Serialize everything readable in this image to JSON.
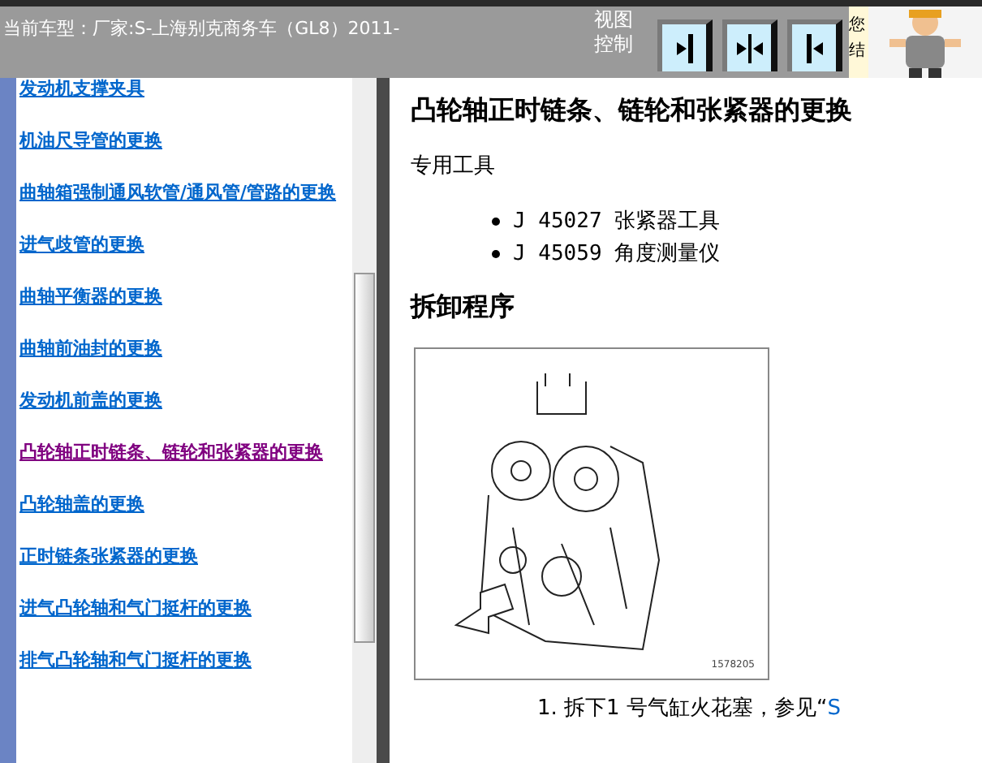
{
  "header": {
    "vehicle": "当前车型：厂家:S-上海别克商务车（GL8）2011-",
    "view_control": "视图控制",
    "side_text": "您结"
  },
  "view_buttons": [
    {
      "kind": "right"
    },
    {
      "kind": "both"
    },
    {
      "kind": "left"
    }
  ],
  "sidebar": {
    "links": [
      {
        "label": "发动机支撑夹具",
        "visited": false
      },
      {
        "label": "机油尺导管的更换",
        "visited": false
      },
      {
        "label": "曲轴箱强制通风软管/通风管/管路的更换",
        "visited": false
      },
      {
        "label": "进气歧管的更换",
        "visited": false
      },
      {
        "label": "曲轴平衡器的更换",
        "visited": false
      },
      {
        "label": "曲轴前油封的更换",
        "visited": false
      },
      {
        "label": "发动机前盖的更换",
        "visited": false
      },
      {
        "label": "凸轮轴正时链条、链轮和张紧器的更换",
        "visited": true
      },
      {
        "label": "凸轮轴盖的更换",
        "visited": false
      },
      {
        "label": "正时链条张紧器的更换",
        "visited": false
      },
      {
        "label": "进气凸轮轴和气门挺杆的更换",
        "visited": false
      },
      {
        "label": "排气凸轮轴和气门挺杆的更换",
        "visited": false
      }
    ]
  },
  "content": {
    "title": "凸轮轴正时链条、链轮和张紧器的更换",
    "tools_heading": "专用工具",
    "tools": [
      "J 45027 张紧器工具",
      "J 45059 角度测量仪"
    ],
    "procedure_heading": "拆卸程序",
    "figure_caption": "1578205",
    "step": {
      "number": "1.",
      "text": "拆下1 号气缸火花塞，参见“",
      "link": "S"
    }
  }
}
